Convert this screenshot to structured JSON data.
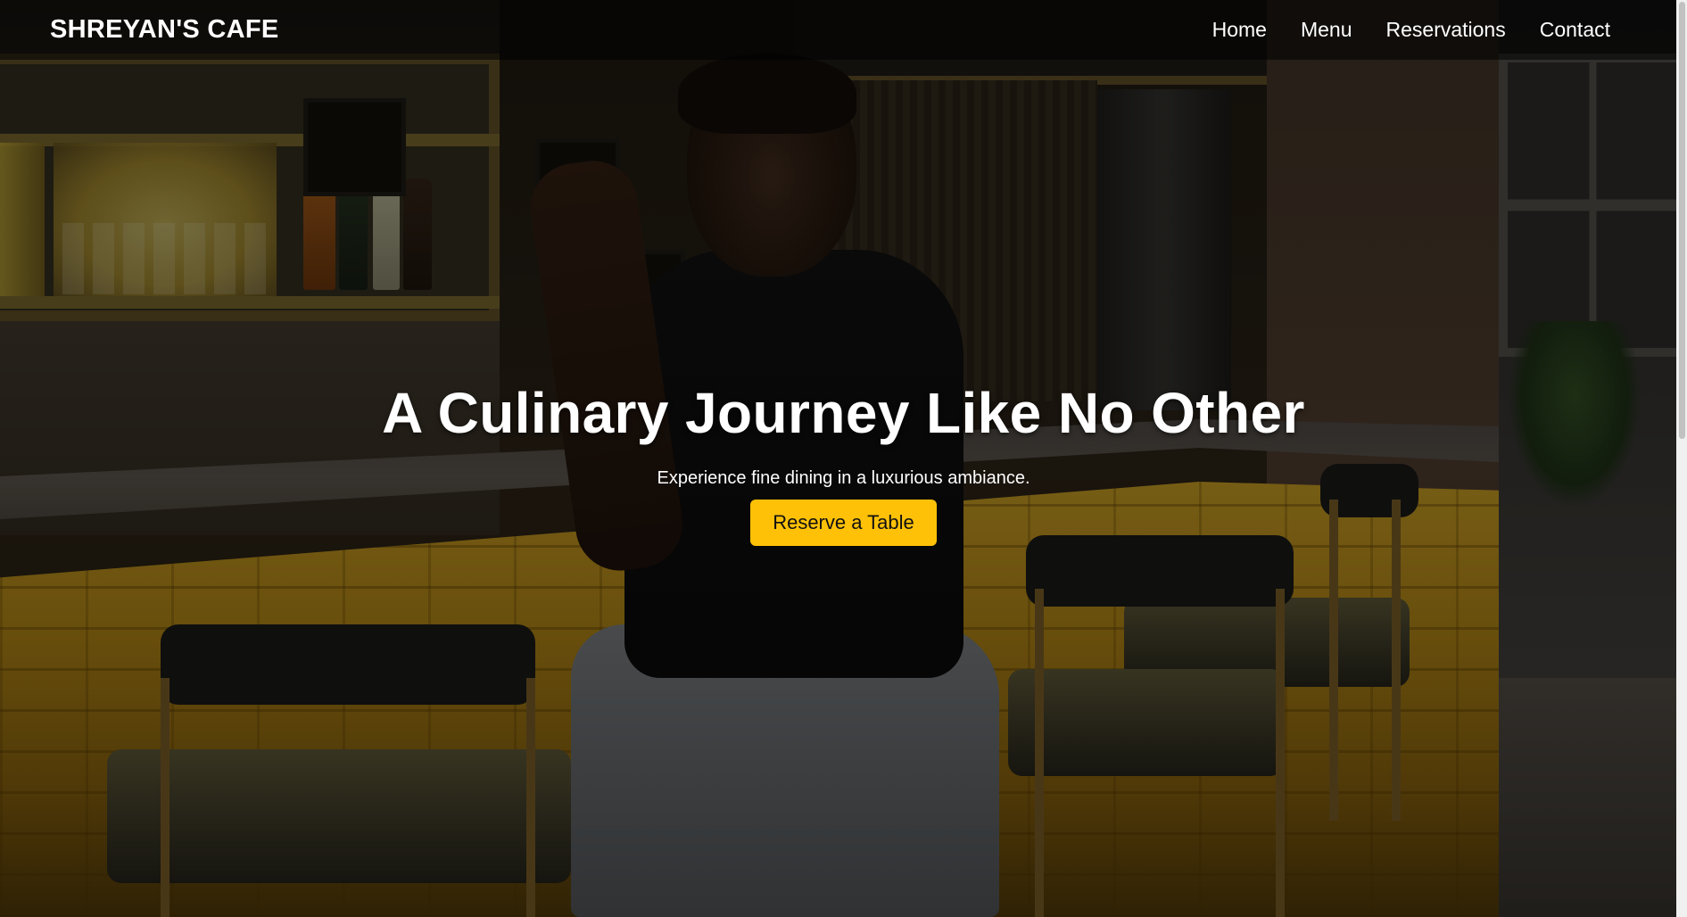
{
  "brand": {
    "name": "SHREYAN'S CAFE"
  },
  "nav": {
    "items": [
      {
        "label": "Home"
      },
      {
        "label": "Menu"
      },
      {
        "label": "Reservations"
      },
      {
        "label": "Contact"
      }
    ]
  },
  "hero": {
    "title": "A Culinary Journey Like No Other",
    "subtitle": "Experience fine dining in a luxurious ambiance.",
    "cta_label": "Reserve a Table",
    "background_image": "man-seated-at-bar-counter-in-cafe-interior"
  },
  "colors": {
    "accent": "#ffc107",
    "text": "#ffffff",
    "navbar_bg": "rgba(0,0,0,0.55)"
  }
}
